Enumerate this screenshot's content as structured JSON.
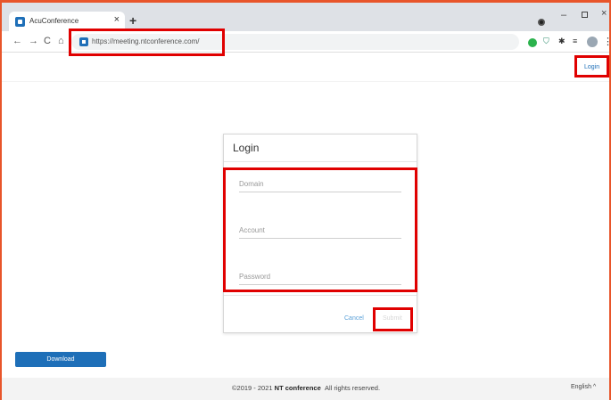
{
  "browser": {
    "tab_title": "AcuConference",
    "tab_close": "×",
    "new_tab": "+",
    "url": "https://meeting.ntconference.com/",
    "win_min": "–",
    "win_close": "×"
  },
  "header": {
    "login_label": "Login"
  },
  "login_form": {
    "title": "Login",
    "domain_placeholder": "Domain",
    "account_placeholder": "Account",
    "password_placeholder": "Password",
    "cancel_label": "Cancel",
    "submit_label": "Submit"
  },
  "download_label": "Download",
  "footer": {
    "copyright_prefix": "©2019 - 2021",
    "brand": "NT conference",
    "rights": "All rights reserved.",
    "language": "English",
    "language_caret": "^"
  },
  "colors": {
    "accent": "#1e6fb8",
    "highlight": "#e00000",
    "frame": "#e8552a"
  }
}
